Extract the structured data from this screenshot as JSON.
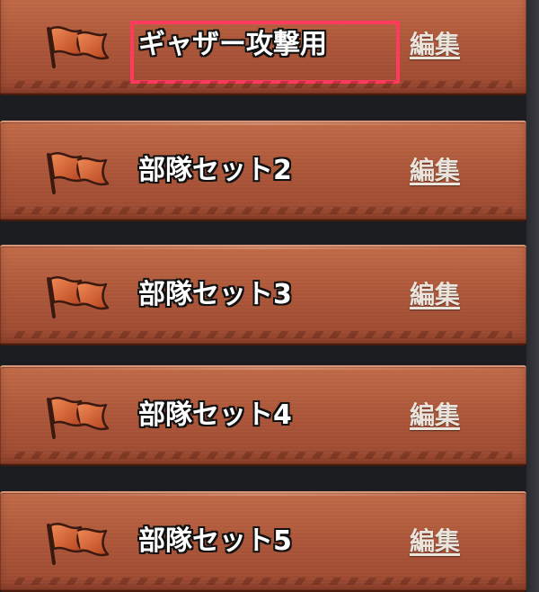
{
  "troop_sets": [
    {
      "name": "ギャザー攻撃用",
      "edit_label": "編集"
    },
    {
      "name": "部隊セット2",
      "edit_label": "編集"
    },
    {
      "name": "部隊セット3",
      "edit_label": "編集"
    },
    {
      "name": "部隊セット4",
      "edit_label": "編集"
    },
    {
      "name": "部隊セット5",
      "edit_label": "編集"
    }
  ],
  "icons": {
    "row_icon": "flag-icon"
  },
  "colors": {
    "row_base": "#ad573a",
    "highlight_border": "#ff3a5c",
    "name_text": "#ffffff",
    "edit_text": "#e9e4dc"
  },
  "highlighted_row": 0
}
